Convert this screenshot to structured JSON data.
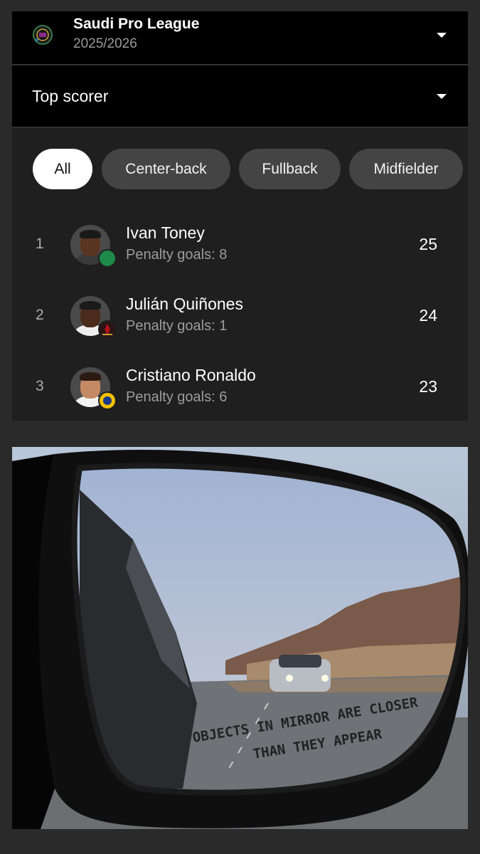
{
  "league": {
    "name": "Saudi Pro League",
    "season": "2025/2026",
    "logo_icon": "league-logo-icon"
  },
  "stat": {
    "label": "Top scorer"
  },
  "filters": [
    {
      "label": "All",
      "active": true
    },
    {
      "label": "Center-back",
      "active": false
    },
    {
      "label": "Fullback",
      "active": false
    },
    {
      "label": "Midfielder",
      "active": false
    }
  ],
  "players": [
    {
      "rank": "1",
      "name": "Ivan Toney",
      "sub": "Penalty goals: 8",
      "goals": "25",
      "club_color": "#1e8a4a"
    },
    {
      "rank": "2",
      "name": "Julián Quiñones",
      "sub": "Penalty goals: 1",
      "goals": "24",
      "club_color": "#b3121d"
    },
    {
      "rank": "3",
      "name": "Cristiano Ronaldo",
      "sub": "Penalty goals: 6",
      "goals": "23",
      "club_color": "#f2c200"
    }
  ],
  "photo": {
    "mirror_line1": "OBJECTS IN MIRROR ARE CLOSER",
    "mirror_line2": "THAN THEY APPEAR"
  }
}
